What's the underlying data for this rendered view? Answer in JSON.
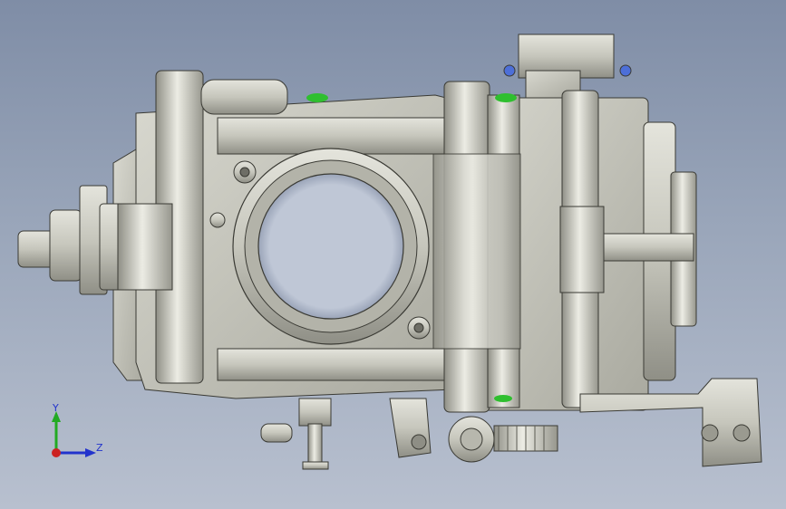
{
  "view": {
    "background_top": "#7f8da6",
    "background_bottom": "#b8c0cf",
    "metal_color": "#c9c9bf",
    "accent_green": "#2fbf2f",
    "accent_blue": "#4d6fd8"
  },
  "triad": {
    "y_label": "Y",
    "z_label": "Z",
    "y_color": "#22aa22",
    "z_color": "#2233cc",
    "x_color": "#cc2222"
  }
}
